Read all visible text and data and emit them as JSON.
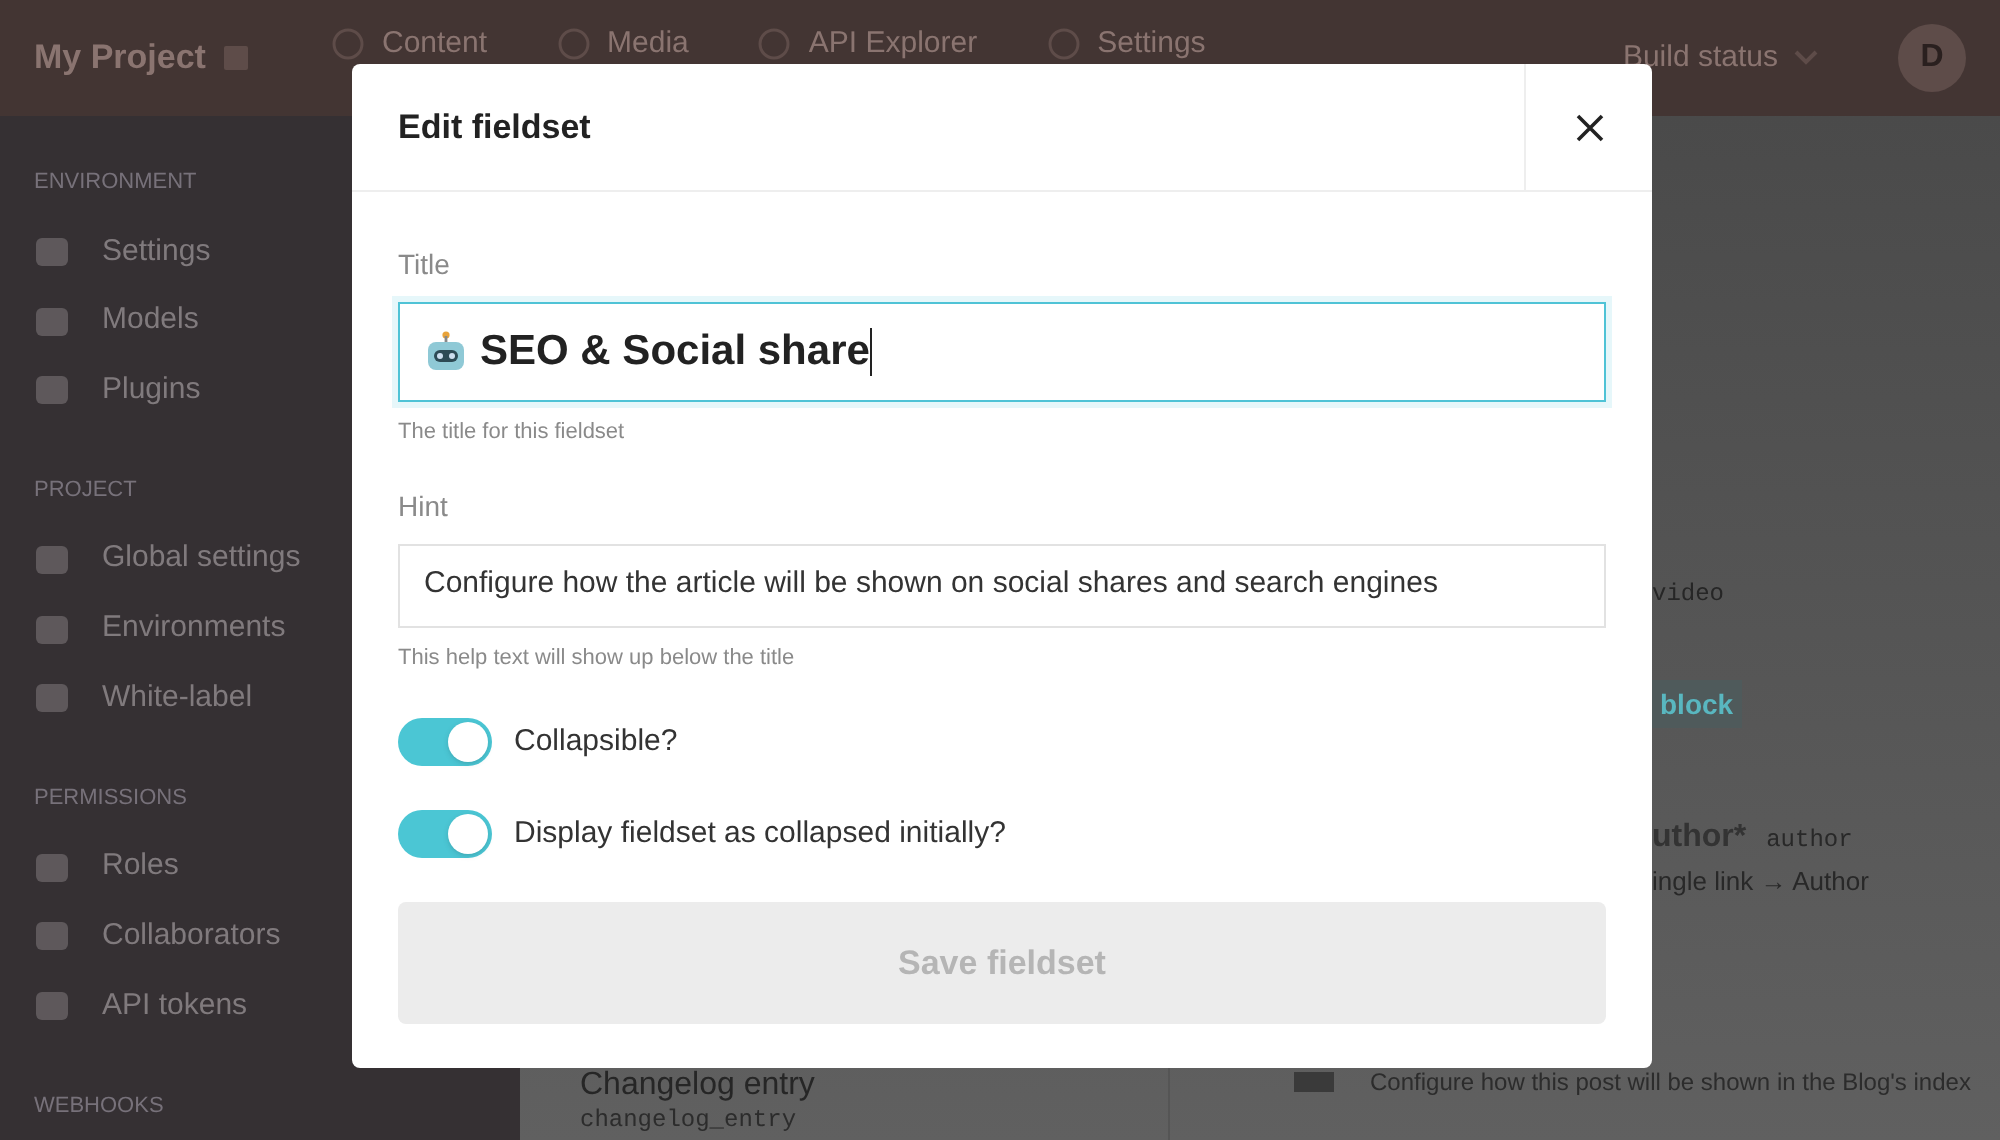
{
  "top_bar": {
    "project": "My Project",
    "nav": [
      {
        "label": "Content"
      },
      {
        "label": "Media"
      },
      {
        "label": "API Explorer"
      },
      {
        "label": "Settings"
      }
    ],
    "build_status": "Build status",
    "avatar": "D"
  },
  "sidebar": {
    "sections": [
      {
        "heading": "ENVIRONMENT",
        "items": [
          {
            "label": "Settings"
          },
          {
            "label": "Models"
          },
          {
            "label": "Plugins"
          }
        ]
      },
      {
        "heading": "PROJECT",
        "items": [
          {
            "label": "Global settings"
          },
          {
            "label": "Environments"
          },
          {
            "label": "White-label"
          }
        ]
      },
      {
        "heading": "PERMISSIONS",
        "items": [
          {
            "label": "Roles"
          },
          {
            "label": "Collaborators"
          },
          {
            "label": "API tokens"
          }
        ]
      },
      {
        "heading": "WEBHOOKS"
      }
    ]
  },
  "main": {
    "left_entry": {
      "title": "Changelog entry",
      "api_key": "changelog_entry"
    },
    "right_rows": [
      {
        "kind": "hint",
        "text": "video"
      },
      {
        "kind": "badge",
        "text": "block"
      },
      {
        "kind": "field",
        "name": "uthor*",
        "api_key": "author",
        "type": "ingle link → Author"
      }
    ],
    "footer_hint": "Configure how this post will be shown in the Blog's index"
  },
  "modal": {
    "title": "Edit fieldset",
    "title_field": {
      "label": "Title",
      "value": "SEO & Social share",
      "help": "The title for this fieldset",
      "focused": true
    },
    "hint_field": {
      "label": "Hint",
      "value": "Configure how the article will be shown on social shares and search engines",
      "help": "This help text will show up below the title",
      "focused": false
    },
    "toggles": [
      {
        "label": "Collapsible?",
        "on": true
      },
      {
        "label": "Display fieldset as collapsed initially?",
        "on": true
      }
    ],
    "save_button": {
      "label": "Save fieldset",
      "disabled": true
    }
  }
}
